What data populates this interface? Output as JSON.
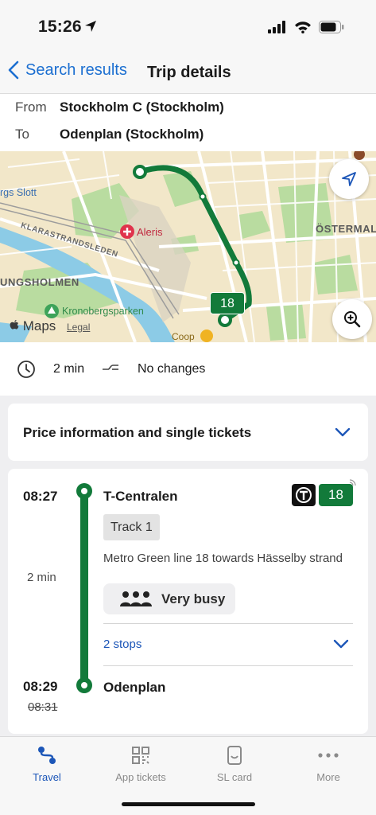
{
  "status": {
    "time": "15:26"
  },
  "nav": {
    "back_label": "Search results",
    "title": "Trip details"
  },
  "trip": {
    "from_label": "From",
    "from_value": "Stockholm C (Stockholm)",
    "to_label": "To",
    "to_value": "Odenplan (Stockholm)"
  },
  "map": {
    "labels": {
      "rgs_slott": "rgs Slott",
      "aleris": "Aleris",
      "klarastrandsleden": "KLARASTRANDSLEDEN",
      "kungsholmen": "UNGSHOLMEN",
      "ostermalm": "ÖSTERMAL",
      "kronobergsparken": "Kronobergsparken",
      "coop": "Coop",
      "maps": "Maps",
      "legal": "Legal"
    },
    "route_badge": "18"
  },
  "summary": {
    "duration": "2 min",
    "changes": "No changes"
  },
  "price": {
    "label": "Price information and single tickets"
  },
  "journey": {
    "departure_time": "08:27",
    "travel_time": "2 min",
    "arrival_time": "08:29",
    "arrival_scheduled": "08:31",
    "from_stop": "T-Centralen",
    "to_stop": "Odenplan",
    "line_number": "18",
    "track": "Track 1",
    "direction": "Metro Green line 18 towards Hässelby strand",
    "crowding": "Very busy",
    "stops": "2 stops"
  },
  "tabs": [
    {
      "label": "Travel",
      "icon": "travel-icon",
      "active": true
    },
    {
      "label": "App tickets",
      "icon": "qr-ticket-icon",
      "active": false
    },
    {
      "label": "SL card",
      "icon": "sl-card-icon",
      "active": false
    },
    {
      "label": "More",
      "icon": "more-icon",
      "active": false
    }
  ],
  "colors": {
    "accent": "#1c56b8",
    "metro_green": "#127a3a"
  }
}
